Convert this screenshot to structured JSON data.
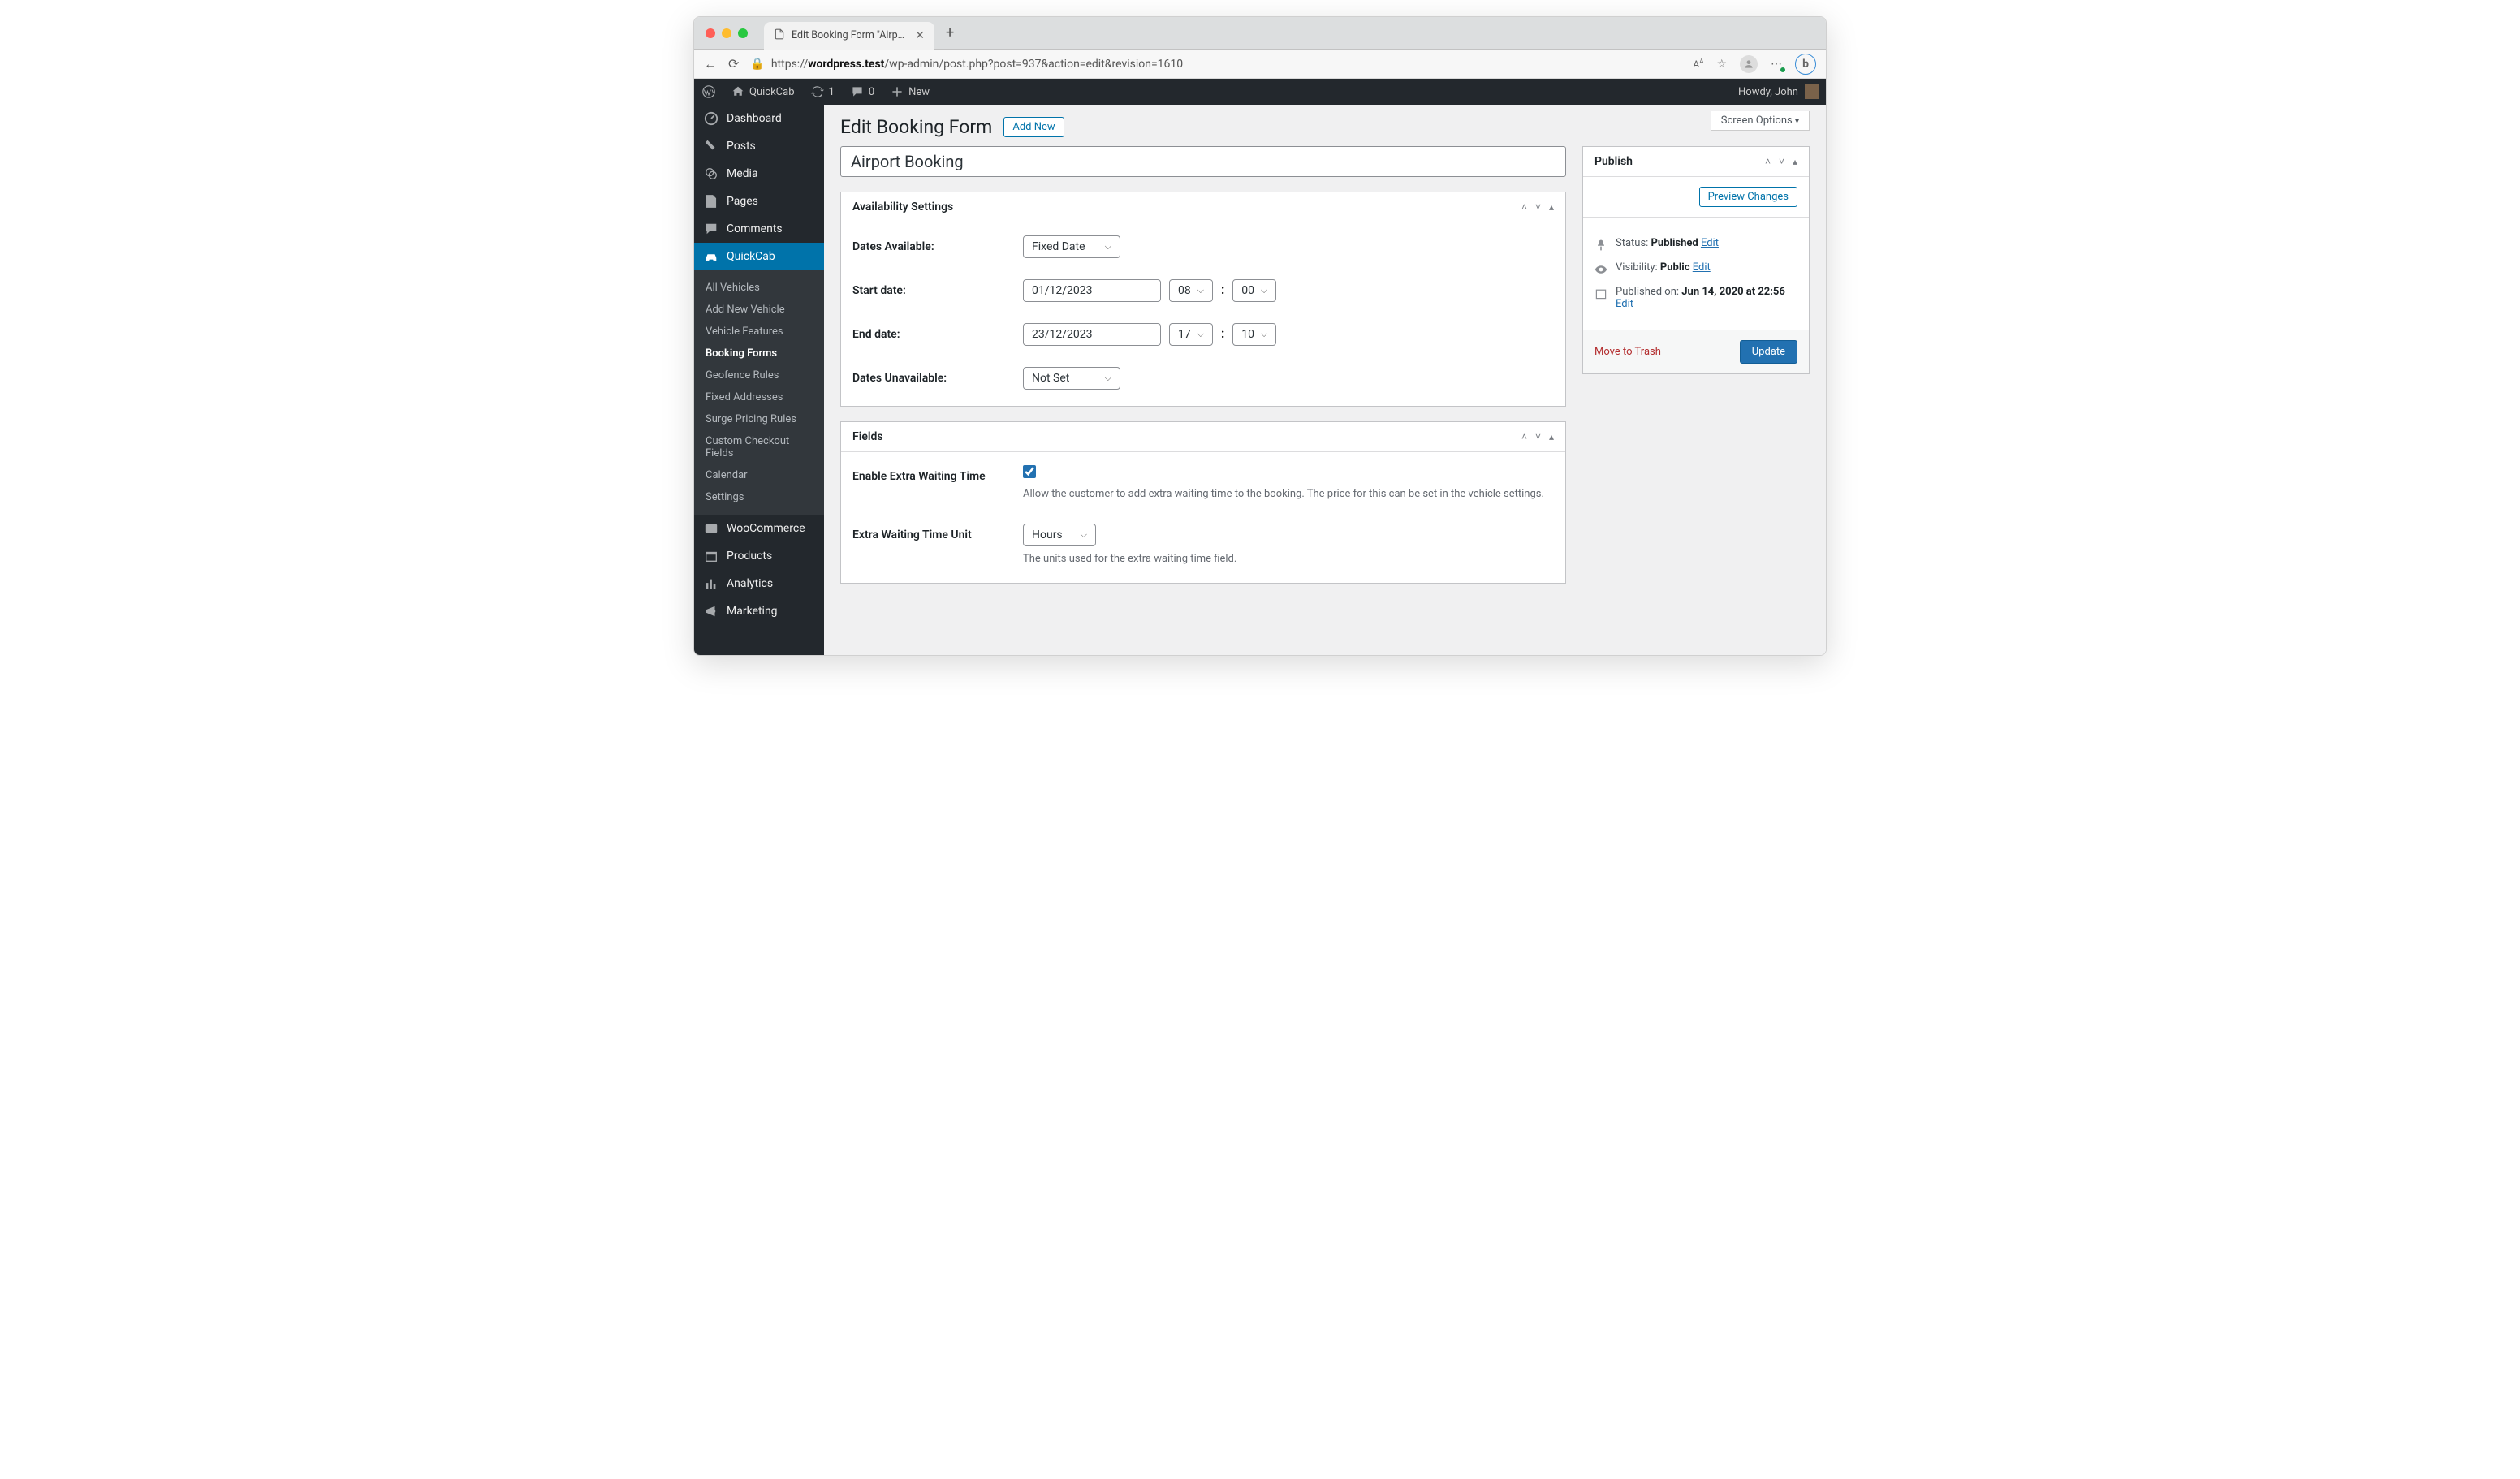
{
  "browser": {
    "tab_title": "Edit Booking Form \"Airport Bo...",
    "url_prefix": "https://",
    "url_host": "wordpress.test",
    "url_path": "/wp-admin/post.php?post=937&action=edit&revision=1610"
  },
  "wp_bar": {
    "site_name": "QuickCab",
    "updates_count": "1",
    "comments_count": "0",
    "new_label": "New",
    "howdy": "Howdy, John"
  },
  "sidebar": {
    "dashboard": "Dashboard",
    "posts": "Posts",
    "media": "Media",
    "pages": "Pages",
    "comments": "Comments",
    "quickcab": "QuickCab",
    "sub": {
      "all_vehicles": "All Vehicles",
      "add_new_vehicle": "Add New Vehicle",
      "vehicle_features": "Vehicle Features",
      "booking_forms": "Booking Forms",
      "geofence_rules": "Geofence Rules",
      "fixed_addresses": "Fixed Addresses",
      "surge_pricing_rules": "Surge Pricing Rules",
      "custom_checkout_fields": "Custom Checkout Fields",
      "calendar": "Calendar",
      "settings": "Settings"
    },
    "woocommerce": "WooCommerce",
    "products": "Products",
    "analytics": "Analytics",
    "marketing": "Marketing"
  },
  "page": {
    "screen_options": "Screen Options",
    "heading": "Edit Booking Form",
    "add_new": "Add New",
    "title_value": "Airport Booking"
  },
  "availability": {
    "box_title": "Availability Settings",
    "dates_available_label": "Dates Available:",
    "dates_available_value": "Fixed Date",
    "start_date_label": "Start date:",
    "start_date_value": "01/12/2023",
    "start_hour": "08",
    "start_min": "00",
    "end_date_label": "End date:",
    "end_date_value": "23/12/2023",
    "end_hour": "17",
    "end_min": "10",
    "dates_unavailable_label": "Dates Unavailable:",
    "dates_unavailable_value": "Not Set"
  },
  "fields_box": {
    "box_title": "Fields",
    "waiting_label": "Enable Extra Waiting Time",
    "waiting_desc": "Allow the customer to add extra waiting time to the booking. The price for this can be set in the vehicle settings.",
    "unit_label": "Extra Waiting Time Unit",
    "unit_value": "Hours",
    "unit_desc": "The units used for the extra waiting time field."
  },
  "publish": {
    "box_title": "Publish",
    "preview_changes": "Preview Changes",
    "status_label": "Status: ",
    "status_value": "Published",
    "visibility_label": "Visibility: ",
    "visibility_value": "Public",
    "published_on_label": "Published on: ",
    "published_on_value": "Jun 14, 2020 at 22:56",
    "edit": "Edit",
    "trash": "Move to Trash",
    "update": "Update"
  }
}
